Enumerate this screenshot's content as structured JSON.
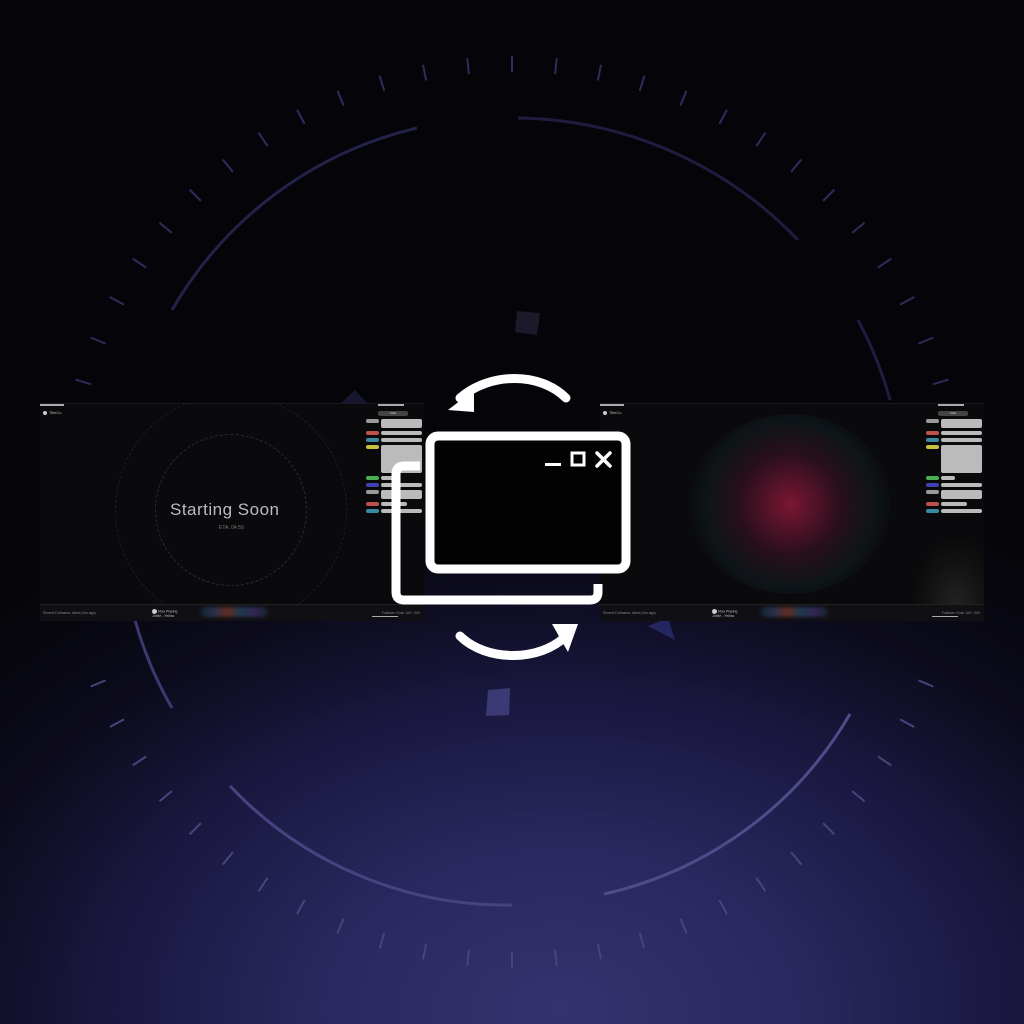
{
  "scenes": [
    {
      "id": "left",
      "logo_text": "TitleCo",
      "chat_title": "Chat",
      "main_title": "Starting Soon",
      "eta": "ETA: 04:59",
      "recent_followers": "Recent Followers: dzirra (4m ago)",
      "follower_goal": "Follower Goal: 100 / 200",
      "now_playing_label": "Now Playing",
      "now_playing_track": "Joelle - Yellow"
    },
    {
      "id": "right",
      "logo_text": "TitleCo",
      "chat_title": "Chat",
      "recent_followers": "Recent Followers: dzirra (4m ago)",
      "follower_goal": "Follower Goal: 100 / 200",
      "now_playing_label": "Now Playing",
      "now_playing_track": "Joelle - Yellow"
    }
  ],
  "icons": {
    "main": "scene-switch-icon",
    "window_controls": [
      "minimize-icon",
      "maximize-icon",
      "close-icon"
    ]
  },
  "colors": {
    "background_accent": "#35336f",
    "icon": "#ffffff"
  }
}
